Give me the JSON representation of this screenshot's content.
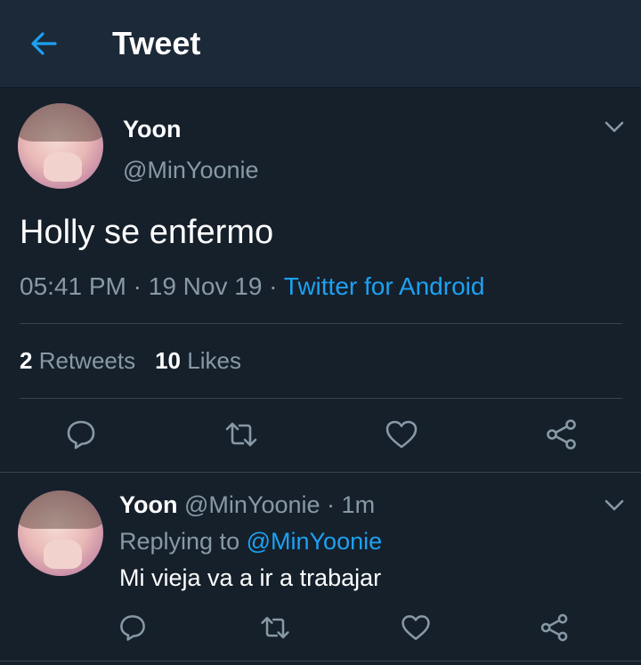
{
  "header": {
    "title": "Tweet",
    "back_icon": "arrow-left-icon",
    "accent": "#1da1f2"
  },
  "tweet": {
    "name": "Yoon",
    "handle": "@MinYoonie",
    "text": "Holly se enfermo",
    "time": "05:41 PM",
    "separator": "·",
    "date": "19 Nov 19",
    "source": "Twitter for Android",
    "retweets_count": "2",
    "retweets_label": "Retweets",
    "likes_count": "10",
    "likes_label": "Likes",
    "actions": [
      "reply-icon",
      "retweet-icon",
      "like-icon",
      "share-icon"
    ]
  },
  "reply": {
    "name": "Yoon",
    "handle": "@MinYoonie",
    "separator": "·",
    "time": "1m",
    "replying_prefix": "Replying to",
    "replying_to": "@MinYoonie",
    "text": "Mi vieja va a ir a trabajar",
    "actions": [
      "reply-icon",
      "retweet-icon",
      "like-icon",
      "share-icon"
    ]
  },
  "colors": {
    "background": "#15202b",
    "header": "#1c2938",
    "secondary_text": "#8899a6",
    "link": "#1da1f2",
    "divider": "#38444d"
  }
}
